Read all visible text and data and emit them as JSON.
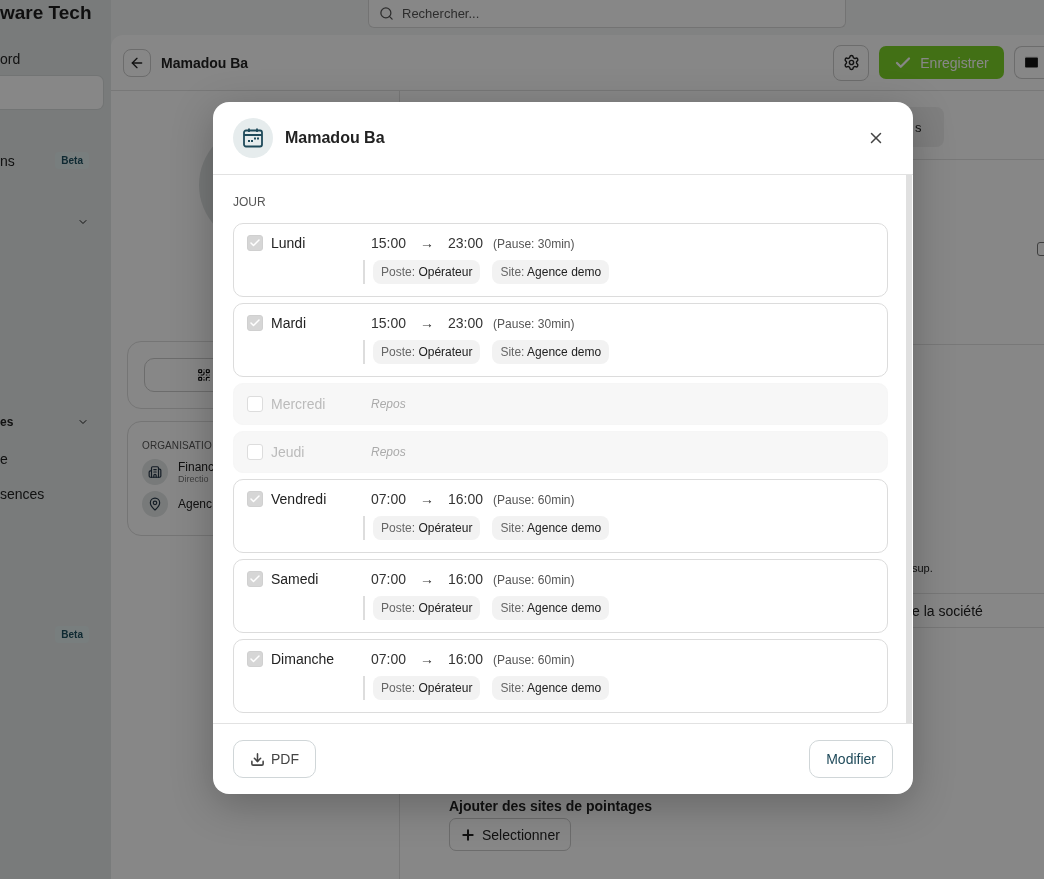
{
  "top_bar": {
    "brand": "ware Tech",
    "search": {
      "placeholder": "Rechercher..."
    }
  },
  "sidebar": {
    "items": [
      {
        "kind": "link",
        "label": "ord",
        "selected": false
      },
      {
        "kind": "link",
        "selected": true
      },
      {
        "kind": "link",
        "label": "ns",
        "badge": "Beta",
        "selected": false
      },
      {
        "kind": "group"
      },
      {
        "kind": "group",
        "label": "es"
      },
      {
        "kind": "link",
        "label": "e",
        "selected": false
      },
      {
        "kind": "link",
        "label": "sences",
        "selected": false
      },
      {
        "kind": "link",
        "badge": "Beta",
        "selected": false
      }
    ]
  },
  "profile": {
    "title": "Mamadou Ba",
    "save_button": "Enregistrer",
    "organisation": {
      "heading": "ORGANISATIO",
      "items": [
        {
          "kind": "department",
          "title": "Financ",
          "subtitle": "Directio"
        },
        {
          "kind": "site",
          "title": "Agenc"
        }
      ]
    },
    "tab": {
      "label": "s"
    },
    "option_checked": false,
    "note": "sup.",
    "company_row": "e la société",
    "sites": {
      "heading": "Ajouter des sites de pointages",
      "button": "Selectionner"
    }
  },
  "modal": {
    "title": "Mamadou Ba",
    "section_label": "JOUR",
    "days": [
      {
        "kind": "work",
        "day": "Lundi",
        "checked": true,
        "start": "15:00",
        "arrow": "→",
        "end": "23:00",
        "pause": "(Pause: 30min)",
        "poste_label": "Poste:",
        "poste": "Opérateur",
        "site_label": "Site:",
        "site": "Agence demo"
      },
      {
        "kind": "work",
        "day": "Mardi",
        "checked": true,
        "start": "15:00",
        "arrow": "→",
        "end": "23:00",
        "pause": "(Pause: 30min)",
        "poste_label": "Poste:",
        "poste": "Opérateur",
        "site_label": "Site:",
        "site": "Agence demo"
      },
      {
        "kind": "rest",
        "day": "Mercredi",
        "checked": false,
        "rest": "Repos"
      },
      {
        "kind": "rest",
        "day": "Jeudi",
        "checked": false,
        "rest": "Repos"
      },
      {
        "kind": "work",
        "day": "Vendredi",
        "checked": true,
        "start": "07:00",
        "arrow": "→",
        "end": "16:00",
        "pause": "(Pause: 60min)",
        "poste_label": "Poste:",
        "poste": "Opérateur",
        "site_label": "Site:",
        "site": "Agence demo"
      },
      {
        "kind": "work",
        "day": "Samedi",
        "checked": true,
        "start": "07:00",
        "arrow": "→",
        "end": "16:00",
        "pause": "(Pause: 60min)",
        "poste_label": "Poste:",
        "poste": "Opérateur",
        "site_label": "Site:",
        "site": "Agence demo"
      },
      {
        "kind": "work",
        "day": "Dimanche",
        "checked": true,
        "start": "07:00",
        "arrow": "→",
        "end": "16:00",
        "pause": "(Pause: 60min)",
        "poste_label": "Poste:",
        "poste": "Opérateur",
        "site_label": "Site:",
        "site": "Agence demo"
      }
    ],
    "footer": {
      "pdf": "PDF",
      "modify": "Modifier"
    }
  }
}
